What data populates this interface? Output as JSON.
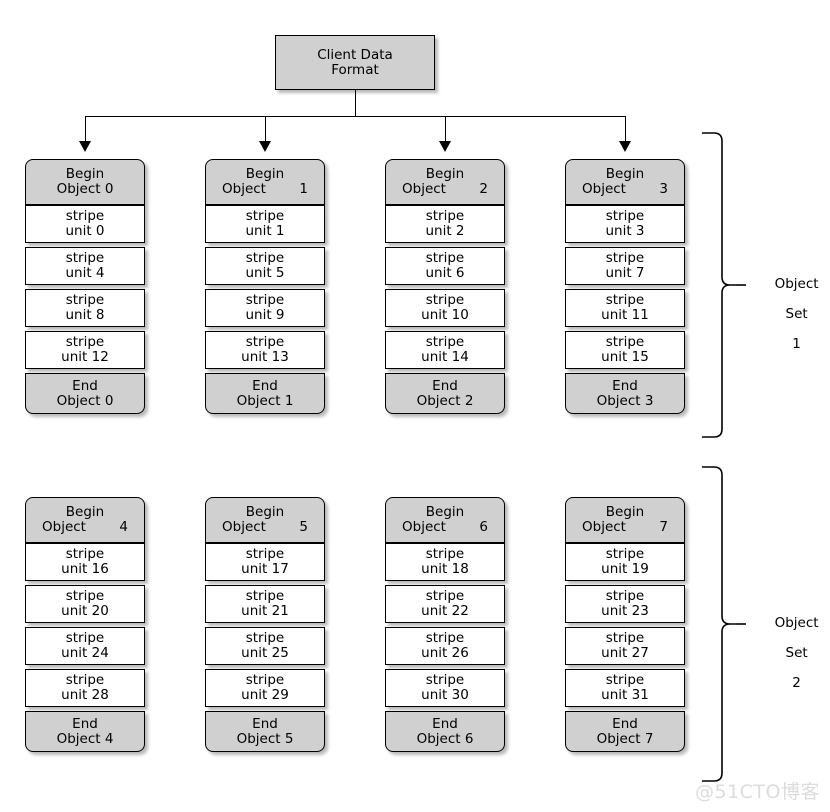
{
  "diagram": {
    "title": "Client Data Format",
    "root": {
      "line1": "Client Data",
      "line2": "Format"
    },
    "columns": [
      {
        "begin": {
          "line1": "Begin",
          "label": "Object",
          "number": "0",
          "spread": false
        },
        "stripes": [
          {
            "line1": "stripe",
            "line2": "unit 0"
          },
          {
            "line1": "stripe",
            "line2": "unit 4"
          },
          {
            "line1": "stripe",
            "line2": "unit 8"
          },
          {
            "line1": "stripe",
            "line2": "unit 12"
          }
        ],
        "end": {
          "line1": "End",
          "line2": "Object 0"
        }
      },
      {
        "begin": {
          "line1": "Begin",
          "label": "Object",
          "number": "1",
          "spread": true
        },
        "stripes": [
          {
            "line1": "stripe",
            "line2": "unit 1"
          },
          {
            "line1": "stripe",
            "line2": "unit 5"
          },
          {
            "line1": "stripe",
            "line2": "unit 9"
          },
          {
            "line1": "stripe",
            "line2": "unit 13"
          }
        ],
        "end": {
          "line1": "End",
          "line2": "Object 1"
        }
      },
      {
        "begin": {
          "line1": "Begin",
          "label": "Object",
          "number": "2",
          "spread": true
        },
        "stripes": [
          {
            "line1": "stripe",
            "line2": "unit 2"
          },
          {
            "line1": "stripe",
            "line2": "unit 6"
          },
          {
            "line1": "stripe",
            "line2": "unit 10"
          },
          {
            "line1": "stripe",
            "line2": "unit 14"
          }
        ],
        "end": {
          "line1": "End",
          "line2": "Object 2"
        }
      },
      {
        "begin": {
          "line1": "Begin",
          "label": "Object",
          "number": "3",
          "spread": true
        },
        "stripes": [
          {
            "line1": "stripe",
            "line2": "unit 3"
          },
          {
            "line1": "stripe",
            "line2": "unit 7"
          },
          {
            "line1": "stripe",
            "line2": "unit 11"
          },
          {
            "line1": "stripe",
            "line2": "unit 15"
          }
        ],
        "end": {
          "line1": "End",
          "line2": "Object 3"
        }
      },
      {
        "begin": {
          "line1": "Begin",
          "label": "Object",
          "number": "4",
          "spread": true
        },
        "stripes": [
          {
            "line1": "stripe",
            "line2": "unit 16"
          },
          {
            "line1": "stripe",
            "line2": "unit 20"
          },
          {
            "line1": "stripe",
            "line2": "unit 24"
          },
          {
            "line1": "stripe",
            "line2": "unit 28"
          }
        ],
        "end": {
          "line1": "End",
          "line2": "Object 4"
        }
      },
      {
        "begin": {
          "line1": "Begin",
          "label": "Object",
          "number": "5",
          "spread": true
        },
        "stripes": [
          {
            "line1": "stripe",
            "line2": "unit 17"
          },
          {
            "line1": "stripe",
            "line2": "unit 21"
          },
          {
            "line1": "stripe",
            "line2": "unit 25"
          },
          {
            "line1": "stripe",
            "line2": "unit 29"
          }
        ],
        "end": {
          "line1": "End",
          "line2": "Object 5"
        }
      },
      {
        "begin": {
          "line1": "Begin",
          "label": "Object",
          "number": "6",
          "spread": true
        },
        "stripes": [
          {
            "line1": "stripe",
            "line2": "unit 18"
          },
          {
            "line1": "stripe",
            "line2": "unit 22"
          },
          {
            "line1": "stripe",
            "line2": "unit 26"
          },
          {
            "line1": "stripe",
            "line2": "unit 30"
          }
        ],
        "end": {
          "line1": "End",
          "line2": "Object 6"
        }
      },
      {
        "begin": {
          "line1": "Begin",
          "label": "Object",
          "number": "7",
          "spread": true
        },
        "stripes": [
          {
            "line1": "stripe",
            "line2": "unit 19"
          },
          {
            "line1": "stripe",
            "line2": "unit 23"
          },
          {
            "line1": "stripe",
            "line2": "unit 27"
          },
          {
            "line1": "stripe",
            "line2": "unit 31"
          }
        ],
        "end": {
          "line1": "End",
          "line2": "Object 7"
        }
      }
    ],
    "braces": [
      {
        "line1": "Object",
        "line2": "Set",
        "line3": "1"
      },
      {
        "line1": "Object",
        "line2": "Set",
        "line3": "2"
      }
    ],
    "watermark": "@51CTO博客",
    "colors": {
      "box_fill_grey": "#d0d0d0",
      "box_fill_white": "#ffffff",
      "border": "#000000",
      "background": "#ffffff",
      "watermark": "#dcdcdc"
    }
  }
}
